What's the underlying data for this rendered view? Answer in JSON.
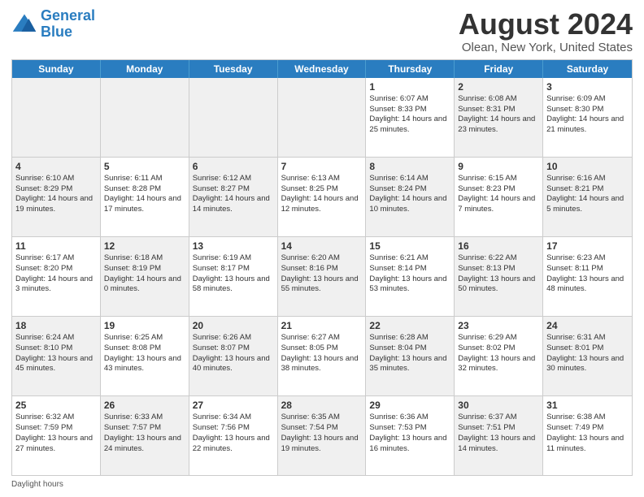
{
  "header": {
    "logo_line1": "General",
    "logo_line2": "Blue",
    "main_title": "August 2024",
    "subtitle": "Olean, New York, United States"
  },
  "days_of_week": [
    "Sunday",
    "Monday",
    "Tuesday",
    "Wednesday",
    "Thursday",
    "Friday",
    "Saturday"
  ],
  "footer": {
    "daylight_label": "Daylight hours"
  },
  "weeks": [
    [
      {
        "day": "",
        "info": "",
        "shaded": true
      },
      {
        "day": "",
        "info": "",
        "shaded": true
      },
      {
        "day": "",
        "info": "",
        "shaded": true
      },
      {
        "day": "",
        "info": "",
        "shaded": true
      },
      {
        "day": "1",
        "info": "Sunrise: 6:07 AM\nSunset: 8:33 PM\nDaylight: 14 hours and 25 minutes.",
        "shaded": false
      },
      {
        "day": "2",
        "info": "Sunrise: 6:08 AM\nSunset: 8:31 PM\nDaylight: 14 hours and 23 minutes.",
        "shaded": true
      },
      {
        "day": "3",
        "info": "Sunrise: 6:09 AM\nSunset: 8:30 PM\nDaylight: 14 hours and 21 minutes.",
        "shaded": false
      }
    ],
    [
      {
        "day": "4",
        "info": "Sunrise: 6:10 AM\nSunset: 8:29 PM\nDaylight: 14 hours and 19 minutes.",
        "shaded": true
      },
      {
        "day": "5",
        "info": "Sunrise: 6:11 AM\nSunset: 8:28 PM\nDaylight: 14 hours and 17 minutes.",
        "shaded": false
      },
      {
        "day": "6",
        "info": "Sunrise: 6:12 AM\nSunset: 8:27 PM\nDaylight: 14 hours and 14 minutes.",
        "shaded": true
      },
      {
        "day": "7",
        "info": "Sunrise: 6:13 AM\nSunset: 8:25 PM\nDaylight: 14 hours and 12 minutes.",
        "shaded": false
      },
      {
        "day": "8",
        "info": "Sunrise: 6:14 AM\nSunset: 8:24 PM\nDaylight: 14 hours and 10 minutes.",
        "shaded": true
      },
      {
        "day": "9",
        "info": "Sunrise: 6:15 AM\nSunset: 8:23 PM\nDaylight: 14 hours and 7 minutes.",
        "shaded": false
      },
      {
        "day": "10",
        "info": "Sunrise: 6:16 AM\nSunset: 8:21 PM\nDaylight: 14 hours and 5 minutes.",
        "shaded": true
      }
    ],
    [
      {
        "day": "11",
        "info": "Sunrise: 6:17 AM\nSunset: 8:20 PM\nDaylight: 14 hours and 3 minutes.",
        "shaded": false
      },
      {
        "day": "12",
        "info": "Sunrise: 6:18 AM\nSunset: 8:19 PM\nDaylight: 14 hours and 0 minutes.",
        "shaded": true
      },
      {
        "day": "13",
        "info": "Sunrise: 6:19 AM\nSunset: 8:17 PM\nDaylight: 13 hours and 58 minutes.",
        "shaded": false
      },
      {
        "day": "14",
        "info": "Sunrise: 6:20 AM\nSunset: 8:16 PM\nDaylight: 13 hours and 55 minutes.",
        "shaded": true
      },
      {
        "day": "15",
        "info": "Sunrise: 6:21 AM\nSunset: 8:14 PM\nDaylight: 13 hours and 53 minutes.",
        "shaded": false
      },
      {
        "day": "16",
        "info": "Sunrise: 6:22 AM\nSunset: 8:13 PM\nDaylight: 13 hours and 50 minutes.",
        "shaded": true
      },
      {
        "day": "17",
        "info": "Sunrise: 6:23 AM\nSunset: 8:11 PM\nDaylight: 13 hours and 48 minutes.",
        "shaded": false
      }
    ],
    [
      {
        "day": "18",
        "info": "Sunrise: 6:24 AM\nSunset: 8:10 PM\nDaylight: 13 hours and 45 minutes.",
        "shaded": true
      },
      {
        "day": "19",
        "info": "Sunrise: 6:25 AM\nSunset: 8:08 PM\nDaylight: 13 hours and 43 minutes.",
        "shaded": false
      },
      {
        "day": "20",
        "info": "Sunrise: 6:26 AM\nSunset: 8:07 PM\nDaylight: 13 hours and 40 minutes.",
        "shaded": true
      },
      {
        "day": "21",
        "info": "Sunrise: 6:27 AM\nSunset: 8:05 PM\nDaylight: 13 hours and 38 minutes.",
        "shaded": false
      },
      {
        "day": "22",
        "info": "Sunrise: 6:28 AM\nSunset: 8:04 PM\nDaylight: 13 hours and 35 minutes.",
        "shaded": true
      },
      {
        "day": "23",
        "info": "Sunrise: 6:29 AM\nSunset: 8:02 PM\nDaylight: 13 hours and 32 minutes.",
        "shaded": false
      },
      {
        "day": "24",
        "info": "Sunrise: 6:31 AM\nSunset: 8:01 PM\nDaylight: 13 hours and 30 minutes.",
        "shaded": true
      }
    ],
    [
      {
        "day": "25",
        "info": "Sunrise: 6:32 AM\nSunset: 7:59 PM\nDaylight: 13 hours and 27 minutes.",
        "shaded": false
      },
      {
        "day": "26",
        "info": "Sunrise: 6:33 AM\nSunset: 7:57 PM\nDaylight: 13 hours and 24 minutes.",
        "shaded": true
      },
      {
        "day": "27",
        "info": "Sunrise: 6:34 AM\nSunset: 7:56 PM\nDaylight: 13 hours and 22 minutes.",
        "shaded": false
      },
      {
        "day": "28",
        "info": "Sunrise: 6:35 AM\nSunset: 7:54 PM\nDaylight: 13 hours and 19 minutes.",
        "shaded": true
      },
      {
        "day": "29",
        "info": "Sunrise: 6:36 AM\nSunset: 7:53 PM\nDaylight: 13 hours and 16 minutes.",
        "shaded": false
      },
      {
        "day": "30",
        "info": "Sunrise: 6:37 AM\nSunset: 7:51 PM\nDaylight: 13 hours and 14 minutes.",
        "shaded": true
      },
      {
        "day": "31",
        "info": "Sunrise: 6:38 AM\nSunset: 7:49 PM\nDaylight: 13 hours and 11 minutes.",
        "shaded": false
      }
    ]
  ]
}
